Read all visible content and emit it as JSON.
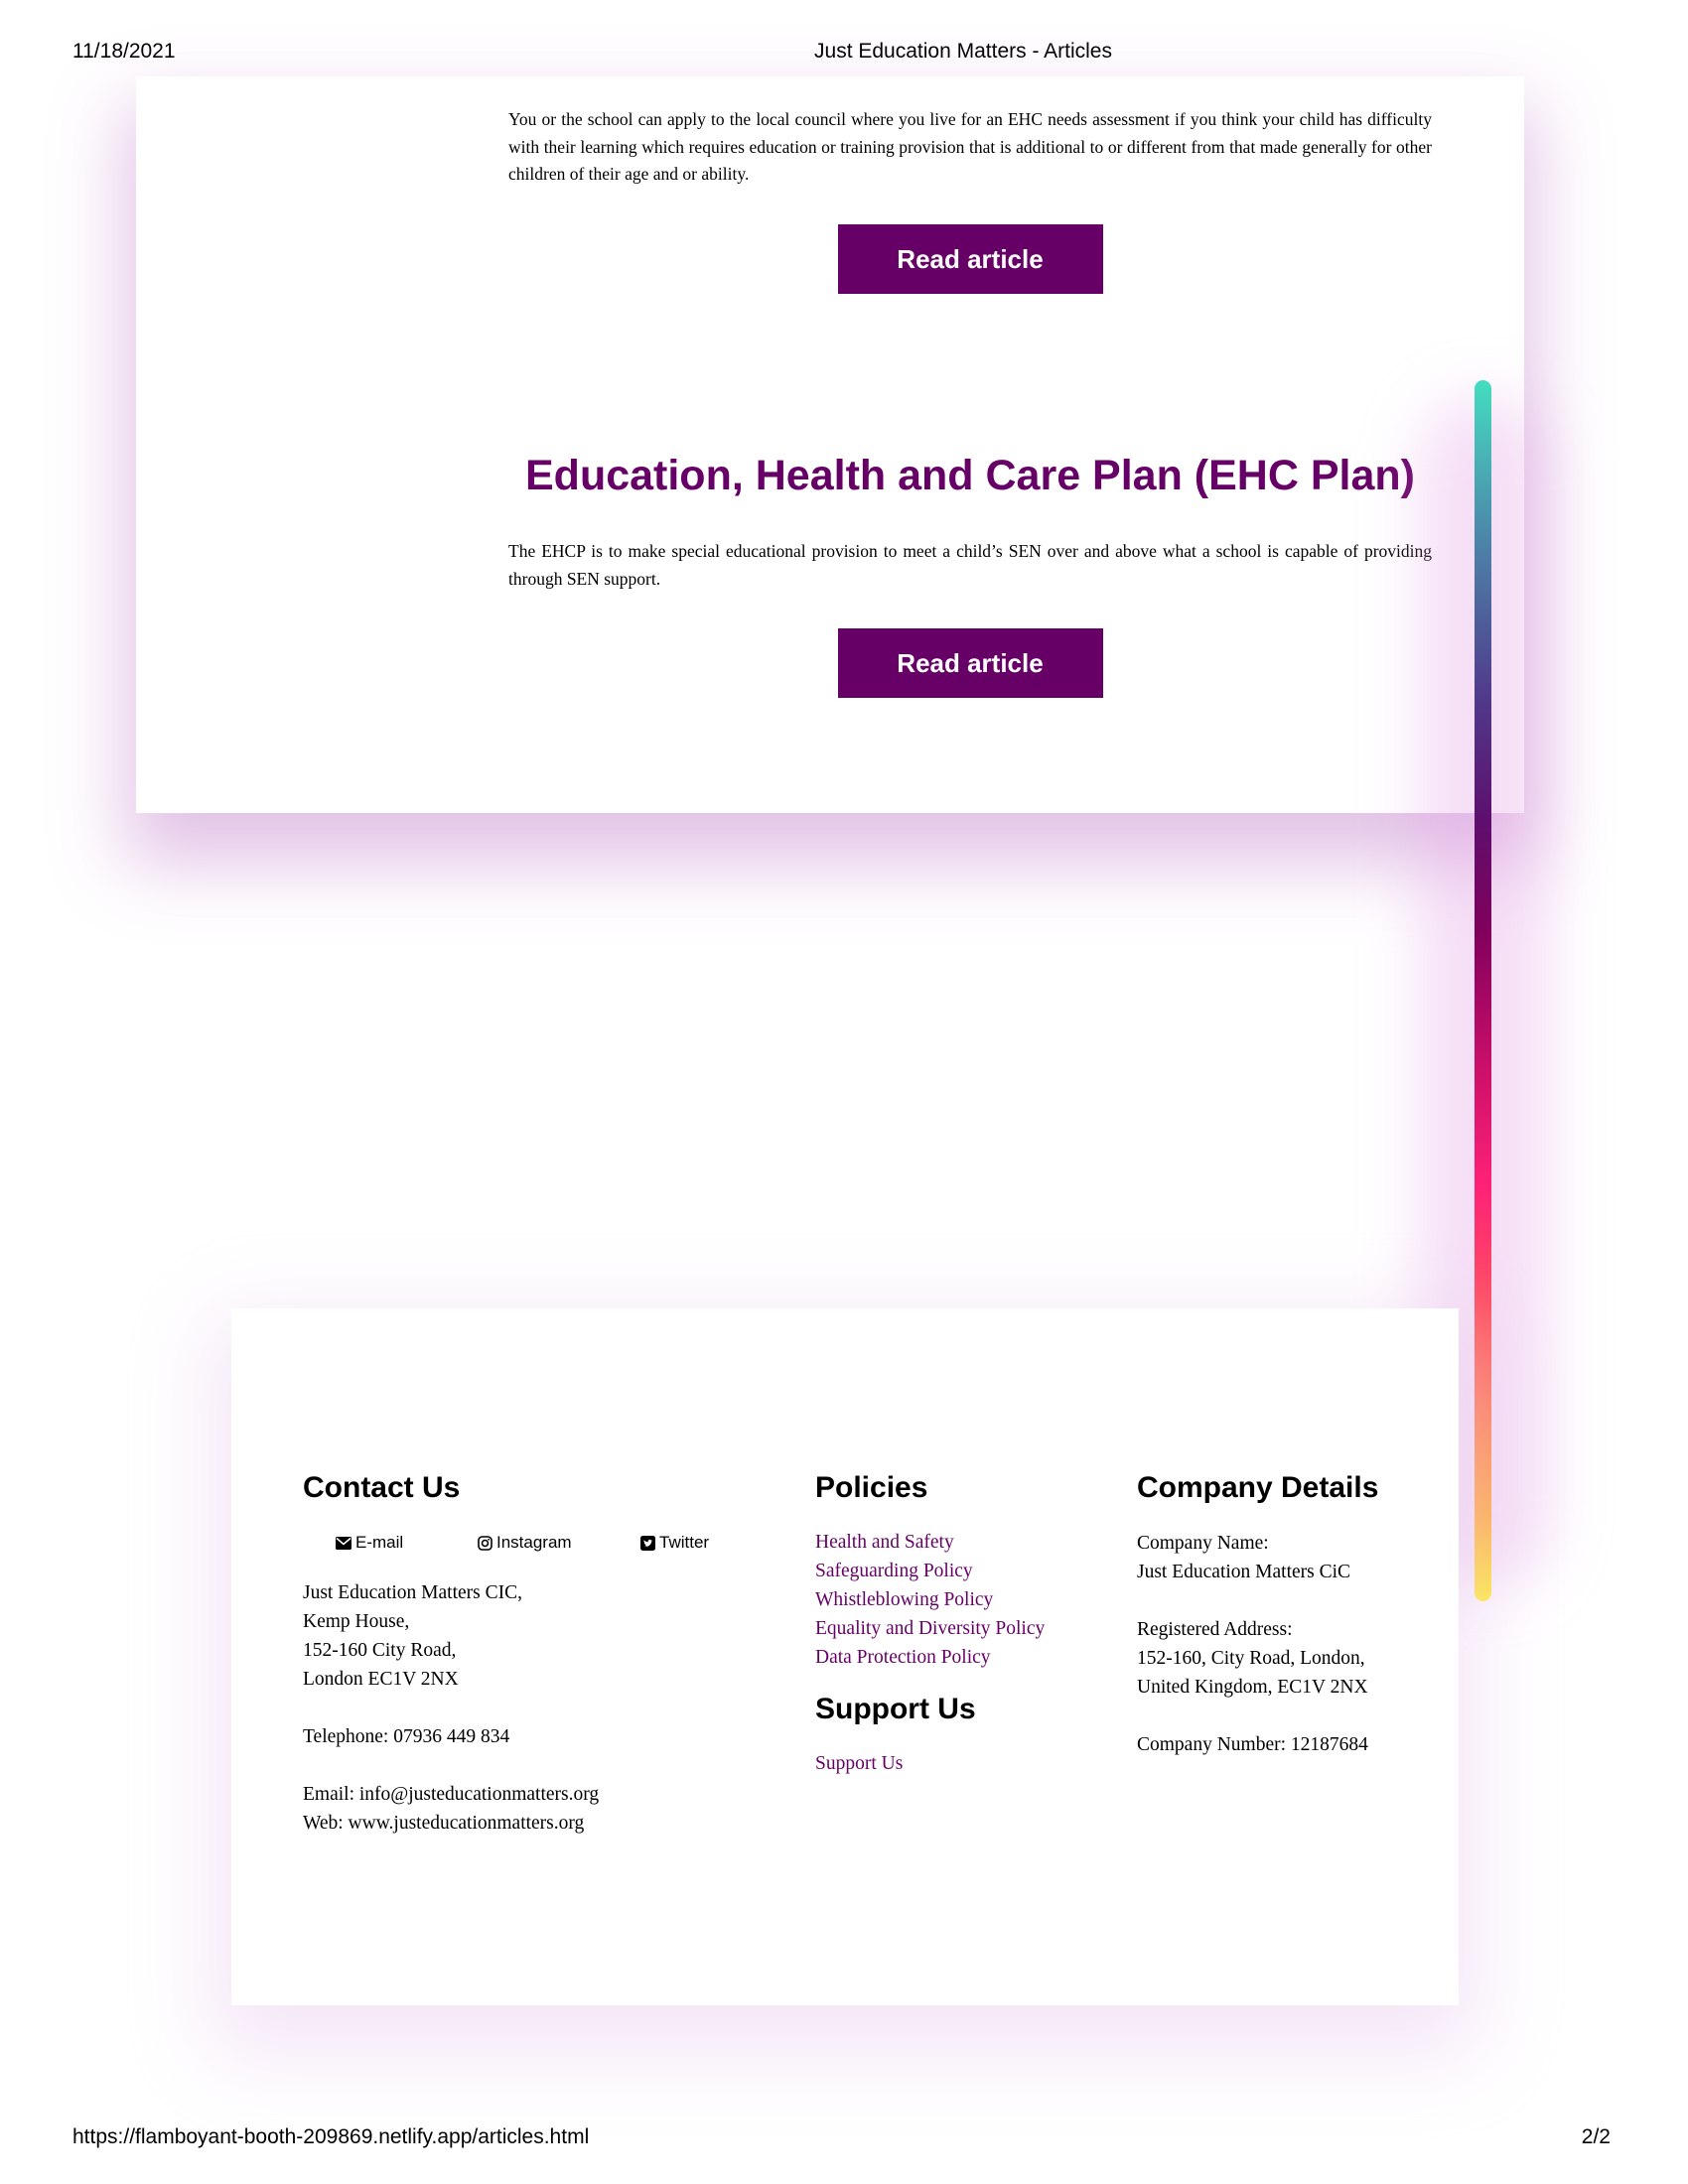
{
  "print_header": {
    "date": "11/18/2021",
    "title": "Just Education Matters - Articles"
  },
  "print_footer": {
    "url": "https://flamboyant-booth-209869.netlify.app/articles.html",
    "page": "2/2"
  },
  "articles": [
    {
      "title": "",
      "summary": "You or the school can apply to the local council where you live for an EHC needs assessment if you think your child has difficulty with their learning which requires education or training provision that is additional to or different from that made generally for other children of their age and or ability.",
      "button_label": "Read article"
    },
    {
      "title": "Education, Health and Care Plan (EHC Plan)",
      "summary": "The EHCP is to make special educational provision to meet a child’s SEN over and above what a school is capable of providing through SEN support.",
      "button_label": "Read article"
    }
  ],
  "scroll_progress": {
    "gradient_colors": [
      "#44ddc0",
      "#503a8a",
      "#660066",
      "#ff2277",
      "#ff8a5c",
      "#ffee44"
    ]
  },
  "footer": {
    "contact": {
      "heading": "Contact Us",
      "social": [
        {
          "label": "E-mail",
          "icon": "envelope-icon"
        },
        {
          "label": "Instagram",
          "icon": "instagram-icon"
        },
        {
          "label": "Twitter",
          "icon": "twitter-icon"
        }
      ],
      "address_lines": [
        "Just Education Matters CIC,",
        "Kemp House,",
        "152-160 City Road,",
        "London EC1V 2NX"
      ],
      "telephone": "Telephone: 07936 449 834",
      "email": "Email: info@justeducationmatters.org",
      "web": "Web: www.justeducationmatters.org"
    },
    "policies": {
      "heading": "Policies",
      "items": [
        "Health and Safety",
        "Safeguarding Policy",
        "Whistleblowing Policy",
        "Equality and Diversity Policy",
        "Data Protection Policy"
      ]
    },
    "support": {
      "heading": "Support Us",
      "link": "Support Us"
    },
    "company": {
      "heading": "Company Details",
      "name_label": "Company Name:",
      "name": "Just Education Matters CiC",
      "address_label": "Registered Address:",
      "address_line1": "152-160, City Road, London,",
      "address_line2": "United Kingdom, EC1V 2NX",
      "number": "Company Number: 12187684"
    }
  },
  "colors": {
    "brand_purple": "#660066",
    "link_purple": "#660066",
    "card_shadow": "#be78c8"
  }
}
